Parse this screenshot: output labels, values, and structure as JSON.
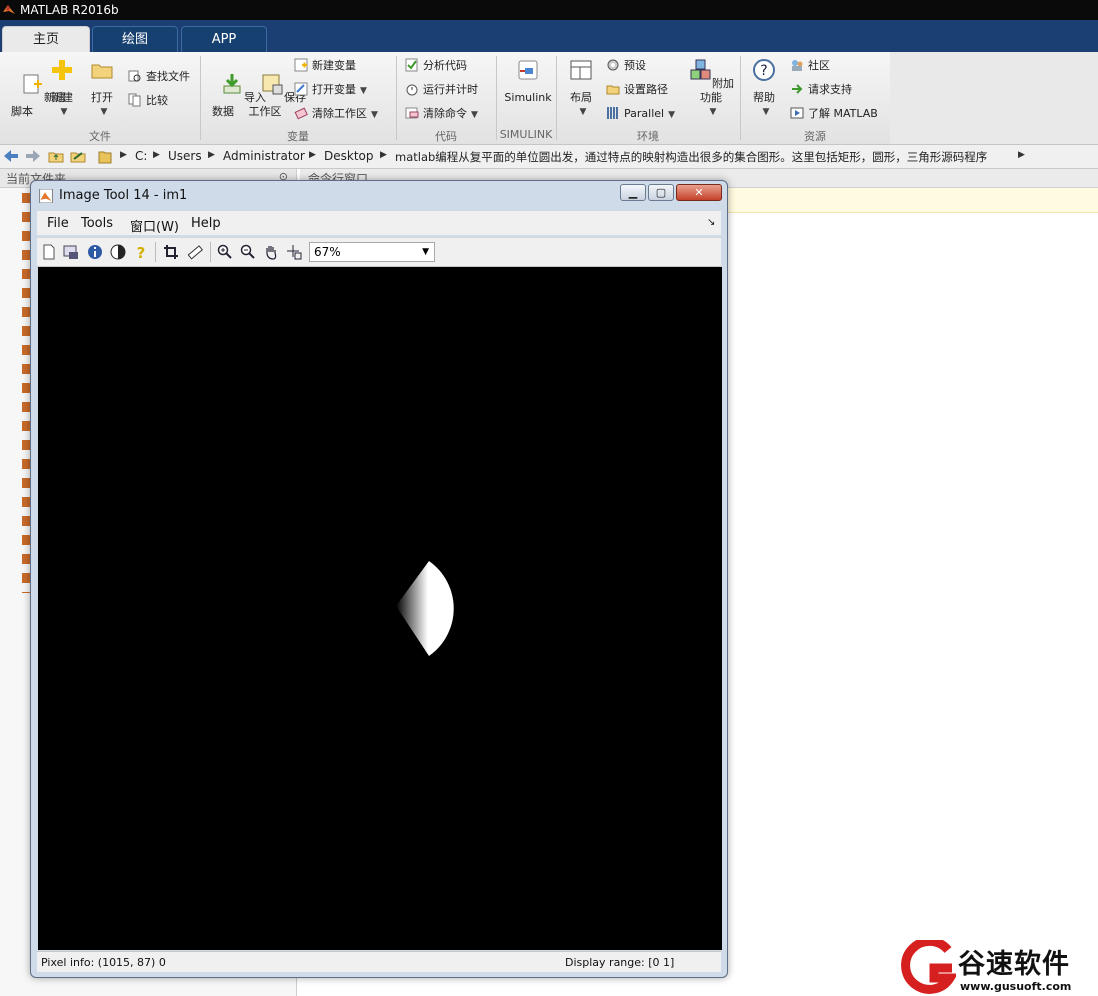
{
  "app": {
    "title": "MATLAB R2016b"
  },
  "tabs": [
    {
      "label": "主页"
    },
    {
      "label": "绘图"
    },
    {
      "label": "APP"
    }
  ],
  "ribbon": {
    "file": {
      "group": "文件",
      "new_script": "新建\n脚本",
      "new": "新建",
      "open": "打开",
      "find_files": "查找文件",
      "compare": "比较"
    },
    "variable": {
      "group": "变量",
      "import": "导入\n数据",
      "save_ws": "保存\n工作区",
      "new_var": "新建变量",
      "open_var": "打开变量",
      "clear_ws": "清除工作区"
    },
    "code": {
      "group": "代码",
      "analyze": "分析代码",
      "run_time": "运行并计时",
      "clear_cmd": "清除命令"
    },
    "simulink": {
      "group": "SIMULINK",
      "simulink": "Simulink"
    },
    "env": {
      "group": "环境",
      "layout": "布局",
      "prefs": "预设",
      "set_path": "设置路径",
      "parallel": "Parallel",
      "addons": "附加功能"
    },
    "resources": {
      "group": "资源",
      "help": "帮助",
      "community": "社区",
      "support": "请求支持",
      "learn": "了解 MATLAB"
    }
  },
  "address": {
    "parts": [
      "C:",
      "Users",
      "Administrator",
      "Desktop",
      "matlab编程从复平面的单位圆出发，通过特点的映射构造出很多的集合图形。这里包括矩形，圆形，三角形源码程序"
    ]
  },
  "panels": {
    "current_folder": "当前文件夹",
    "command_window": "命令行窗口"
  },
  "image_tool": {
    "title": "Image Tool 14 - im1",
    "menu": [
      "File",
      "Tools",
      "窗口(W)",
      "Help"
    ],
    "zoom": "67%",
    "pixel_info": "Pixel info: (1015, 87)  0",
    "display_range": "Display range: [0 1]"
  },
  "watermark": {
    "brand": "谷速软件",
    "url": "www.gusuoft.com"
  },
  "colors": {
    "ribbon_tab_bg": "#1b3f73",
    "accent": "#c4412a",
    "watermark_red": "#d62020"
  }
}
